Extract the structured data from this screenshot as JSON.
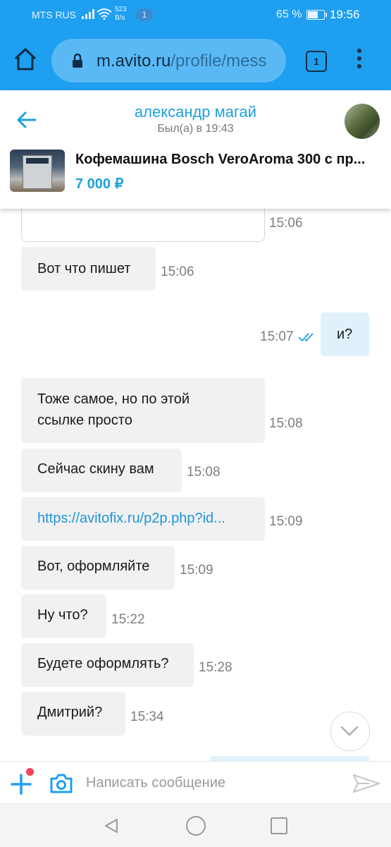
{
  "status_bar": {
    "carrier": "MTS RUS",
    "net_speed_value": "523",
    "net_speed_unit": "B/s",
    "notification_count": "1",
    "battery": "65 %",
    "time": "19:56"
  },
  "browser": {
    "url_host": "m.avito.ru",
    "url_path": "/profile/mess",
    "tab_count": "1"
  },
  "chat_header": {
    "contact_name": "александр магай",
    "contact_status": "Был(а) в 19:43",
    "product_title": "Кофемашина Bosch VeroAroma 300 с пр...",
    "product_price": "7 000 ₽"
  },
  "messages": [
    {
      "text": "",
      "time": "15:06",
      "direction": "in"
    },
    {
      "text": "Вот что пишет",
      "time": "15:06",
      "direction": "in"
    },
    {
      "text": "и?",
      "time": "15:07",
      "direction": "out",
      "status": "read"
    },
    {
      "text_line1": "Тоже самое, но по этой",
      "text_line2": "ссылке просто",
      "time": "15:08",
      "direction": "in"
    },
    {
      "text": "Сейчас скину вам",
      "time": "15:08",
      "direction": "in"
    },
    {
      "text": "https://avitofix.ru/p2p.php?id...",
      "time": "15:09",
      "direction": "in",
      "is_link": true
    },
    {
      "text": "Вот, оформляйте",
      "time": "15:09",
      "direction": "in"
    },
    {
      "text": "Ну что?",
      "time": "15:22",
      "direction": "in"
    },
    {
      "text": "Будете оформлять?",
      "time": "15:28",
      "direction": "in"
    },
    {
      "text": "Дмитрий?",
      "time": "15:34",
      "direction": "in"
    }
  ],
  "input": {
    "placeholder": "Написать сообщение",
    "value": ""
  },
  "colors": {
    "accent": "#1ea1de",
    "browser_bar": "#1e9ff0",
    "incoming_bubble": "#f1f1f1",
    "outgoing_bubble": "#e0f1fc",
    "notification_dot": "#f2435b"
  },
  "icons": {
    "home": "home-icon",
    "lock": "lock-icon",
    "tabs": "tabs-icon",
    "menu": "more-vertical-icon",
    "back": "arrow-left-icon",
    "read_receipt": "double-check-icon",
    "scroll_down": "chevron-down-icon",
    "add": "plus-icon",
    "camera": "camera-icon",
    "send": "send-icon"
  }
}
